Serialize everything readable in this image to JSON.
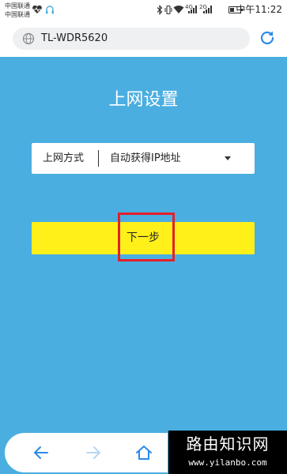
{
  "status_bar": {
    "carrier_1": "中国联通",
    "carrier_2": "中国联通",
    "network_label": "4G",
    "network_label_2": "2G",
    "time": "中午11:22"
  },
  "address_bar": {
    "url": "TL-WDR5620",
    "icons": [
      "globe-icon",
      "reload-icon"
    ]
  },
  "page": {
    "title": "上网设置",
    "connection_label": "上网方式",
    "connection_value": "自动获得IP地址",
    "next_button": "下一步"
  },
  "nav": {
    "icons": [
      "back-arrow-icon",
      "forward-arrow-icon",
      "home-icon"
    ]
  },
  "watermark": {
    "title": "路由知识网",
    "url": "www.yilanbo.com"
  },
  "colors": {
    "page_background": "#4aaee0",
    "button": "#fff01a",
    "highlight": "#e3202a"
  }
}
